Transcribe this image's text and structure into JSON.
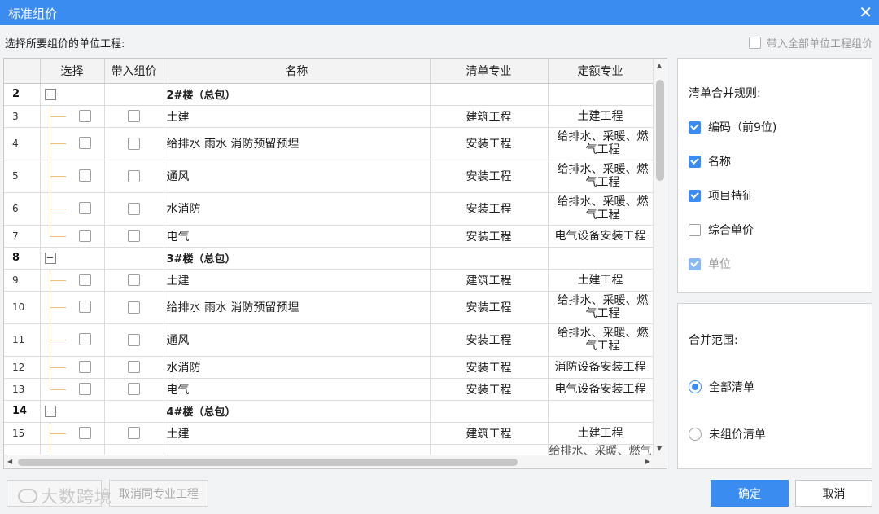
{
  "window": {
    "title": "标准组价",
    "close_icon": "close-icon"
  },
  "select_label": "选择所要组价的单位工程:",
  "bring_all_label": "带入全部单位工程组价",
  "columns": [
    "选择",
    "带入组价",
    "名称",
    "清单专业",
    "定额专业"
  ],
  "rows": [
    {
      "num": "2",
      "group": true,
      "name": "2#楼（总包）",
      "list_major": "",
      "quota_major": ""
    },
    {
      "num": "3",
      "group": false,
      "name": "土建",
      "list_major": "建筑工程",
      "quota_major": "土建工程"
    },
    {
      "num": "4",
      "group": false,
      "name": "给排水 雨水 消防预留预埋",
      "list_major": "安装工程",
      "quota_major": "给排水、采暖、燃气工程",
      "tall": true
    },
    {
      "num": "5",
      "group": false,
      "name": "通风",
      "list_major": "安装工程",
      "quota_major": "给排水、采暖、燃气工程",
      "tall": true
    },
    {
      "num": "6",
      "group": false,
      "name": "水消防",
      "list_major": "安装工程",
      "quota_major": "给排水、采暖、燃气工程",
      "tall": true
    },
    {
      "num": "7",
      "group": false,
      "name": "电气",
      "list_major": "安装工程",
      "quota_major": "电气设备安装工程",
      "last": true
    },
    {
      "num": "8",
      "group": true,
      "name": "3#楼（总包）",
      "list_major": "",
      "quota_major": ""
    },
    {
      "num": "9",
      "group": false,
      "name": "土建",
      "list_major": "建筑工程",
      "quota_major": "土建工程"
    },
    {
      "num": "10",
      "group": false,
      "name": "给排水 雨水 消防预留预埋",
      "list_major": "安装工程",
      "quota_major": "给排水、采暖、燃气工程",
      "tall": true
    },
    {
      "num": "11",
      "group": false,
      "name": "通风",
      "list_major": "安装工程",
      "quota_major": "给排水、采暖、燃气工程",
      "tall": true
    },
    {
      "num": "12",
      "group": false,
      "name": "水消防",
      "list_major": "安装工程",
      "quota_major": "消防设备安装工程"
    },
    {
      "num": "13",
      "group": false,
      "name": "电气",
      "list_major": "安装工程",
      "quota_major": "电气设备安装工程",
      "last": true
    },
    {
      "num": "14",
      "group": true,
      "name": "4#楼（总包）",
      "list_major": "",
      "quota_major": ""
    },
    {
      "num": "15",
      "group": false,
      "name": "土建",
      "list_major": "建筑工程",
      "quota_major": "土建工程"
    },
    {
      "num": "",
      "group": false,
      "name": "",
      "list_major": "",
      "quota_major": "给排水、采暖、燃气",
      "partial": true
    }
  ],
  "merge_rules": {
    "title": "清单合并规则:",
    "options": [
      {
        "label": "编码（前9位)",
        "checked": true
      },
      {
        "label": "名称",
        "checked": true
      },
      {
        "label": "项目特征",
        "checked": true
      },
      {
        "label": "综合单价",
        "checked": false
      },
      {
        "label": "单位",
        "checked": true,
        "disabled": true
      }
    ]
  },
  "merge_scope": {
    "title": "合并范围:",
    "options": [
      {
        "label": "全部清单",
        "selected": true
      },
      {
        "label": "未组价清单",
        "selected": false
      }
    ]
  },
  "buttons": {
    "ok": "确定",
    "cancel": "取消",
    "cancel_same_major": "取消同专业工程"
  },
  "watermark": "大数跨境"
}
